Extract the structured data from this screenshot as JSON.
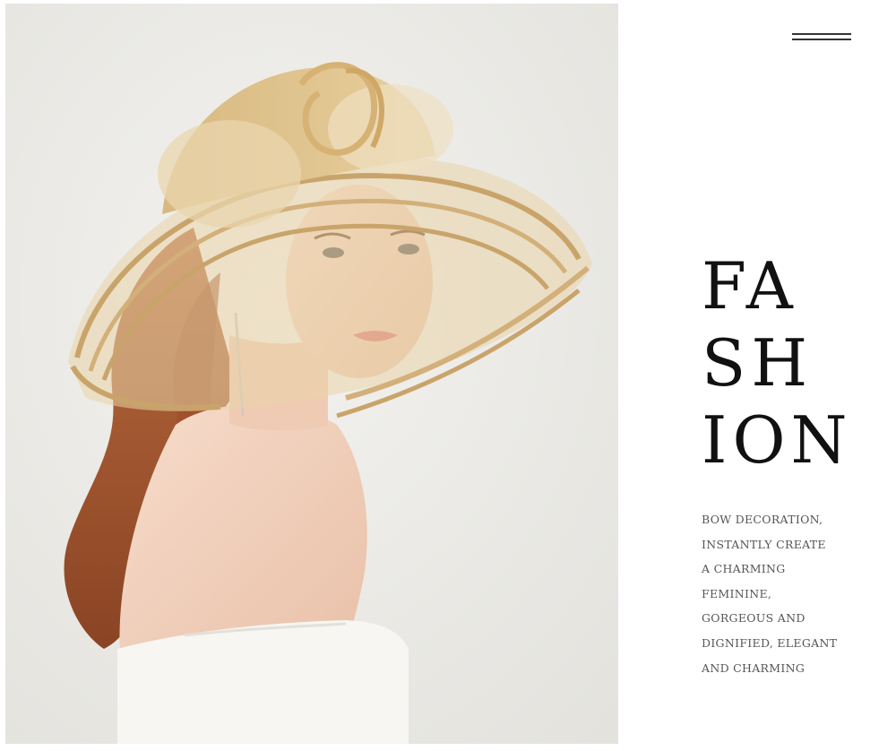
{
  "hero": {
    "image_label": "model-wearing-wide-brim-organza-bow-hat"
  },
  "nav": {
    "menu_icon": "hamburger-menu-icon"
  },
  "headline": {
    "lines": [
      "FA",
      "SH",
      "ION"
    ]
  },
  "description": {
    "lines": [
      "BOW DECORATION,",
      "INSTANTLY CREATE",
      "A CHARMING",
      "FEMININE,",
      "GORGEOUS AND",
      "DIGNIFIED, ELEGANT",
      "AND CHARMING"
    ]
  },
  "colors": {
    "background": "#ffffff",
    "photo_background": "#ecebe7",
    "hat": "#d8b980",
    "hat_stripe": "#c9a46a",
    "hair": "#a0552f",
    "skin": "#f2d3bf",
    "dress": "#f7f6f2",
    "headline": "#111111",
    "body_text": "#555555"
  }
}
